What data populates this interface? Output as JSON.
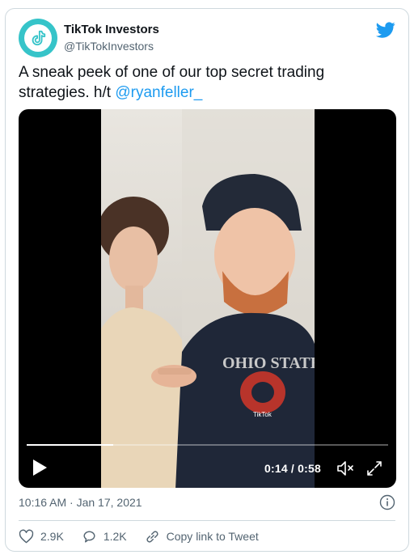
{
  "author": {
    "display_name": "TikTok Investors",
    "handle": "@TikTokInvestors"
  },
  "tweet": {
    "text": "A sneak peek of one of our top secret trading strategies. h/t ",
    "mention": "@ryanfeller_"
  },
  "video": {
    "current_time": "0:14",
    "duration": "0:58",
    "progress_fraction": 0.24,
    "shirt_text": "OHIO STATE",
    "watermark": "TikTok"
  },
  "meta": {
    "timestamp": "10:16 AM · Jan 17, 2021"
  },
  "actions": {
    "likes": "2.9K",
    "replies": "1.2K",
    "copy_link": "Copy link to Tweet"
  },
  "colors": {
    "accent": "#1d9bf0",
    "tiktok_avatar": "#36c4c9"
  },
  "icons": [
    "tiktok-logo-icon",
    "twitter-bird-icon",
    "play-icon",
    "volume-icon",
    "fullscreen-icon",
    "info-icon",
    "heart-icon",
    "reply-icon",
    "link-icon"
  ]
}
